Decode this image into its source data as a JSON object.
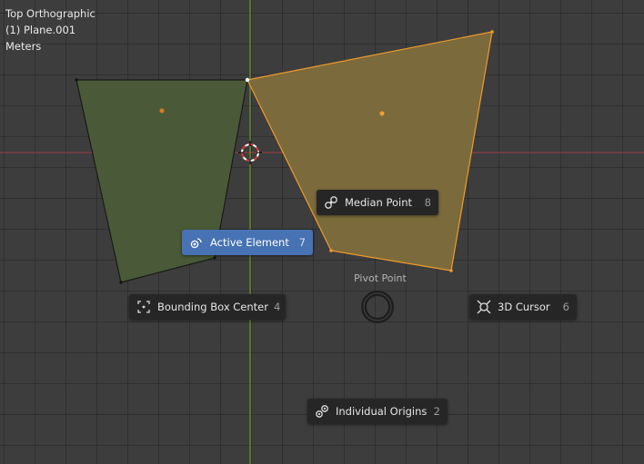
{
  "viewport": {
    "view_name": "Top Orthographic",
    "object_name": "(1) Plane.001",
    "units": "Meters"
  },
  "pie_menu": {
    "title": "Pivot Point",
    "items": [
      {
        "label": "Median Point",
        "shortcut": "8",
        "icon": "median-point-icon"
      },
      {
        "label": "Active Element",
        "shortcut": "7",
        "icon": "active-element-icon",
        "active": true
      },
      {
        "label": "Bounding Box Center",
        "shortcut": "4",
        "icon": "bounding-box-center-icon"
      },
      {
        "label": "3D Cursor",
        "shortcut": "6",
        "icon": "3d-cursor-icon"
      },
      {
        "label": "Individual Origins",
        "shortcut": "2",
        "icon": "individual-origins-icon"
      }
    ]
  },
  "colors": {
    "background": "#3d3d3d",
    "x_axis": "#a13a41",
    "y_axis": "#6f9a24",
    "left_face": "#4a5a38",
    "right_face": "#7b6a3c",
    "selection_edge": "#f09a2a",
    "active_button": "#4772b3",
    "menu_button": "#262626"
  }
}
